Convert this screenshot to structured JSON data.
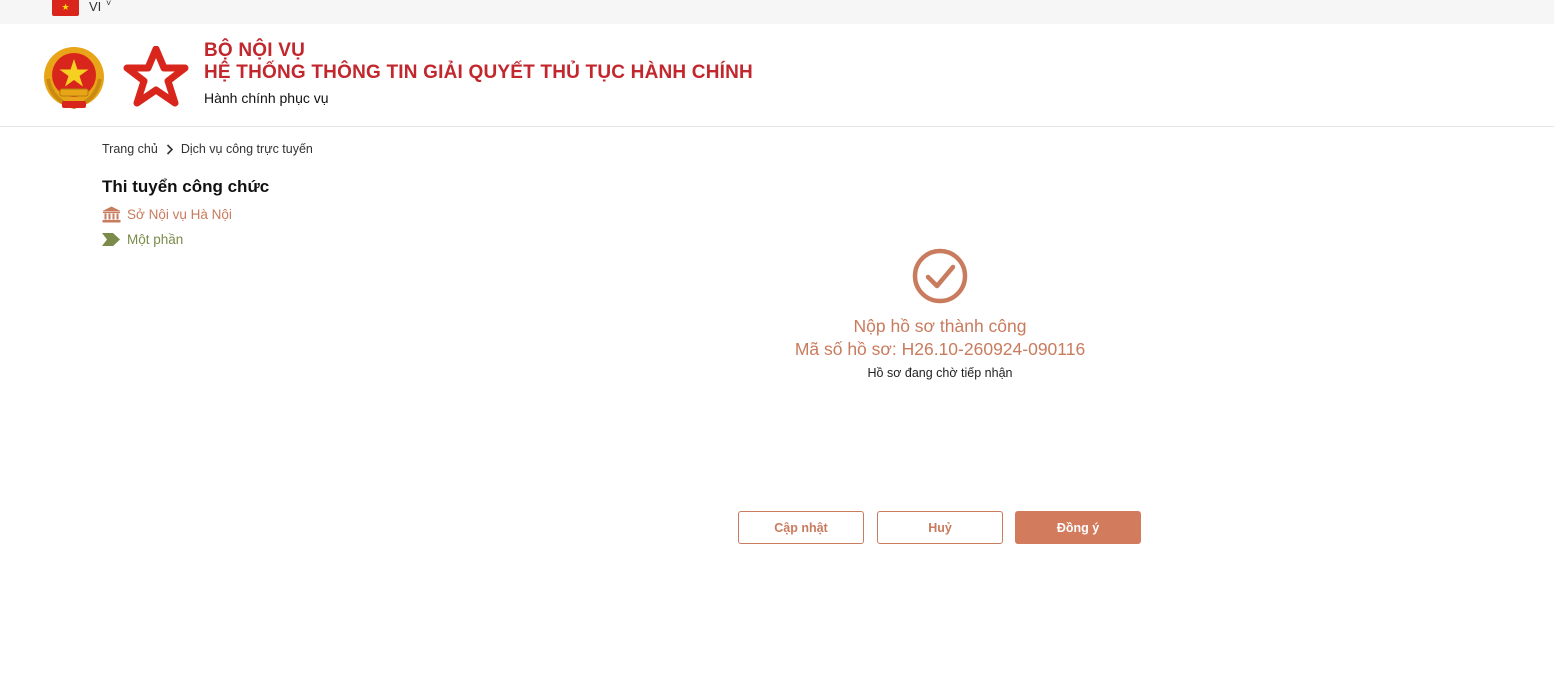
{
  "topbar": {
    "language": "VI",
    "chevron": "˅",
    "flag_icon": "vietnam-flag-icon"
  },
  "header": {
    "ministry": "BỘ NỘI VỤ",
    "system_title": "HỆ THỐNG THÔNG TIN GIẢI QUYẾT THỦ TỤC HÀNH CHÍNH",
    "slogan": "Hành chính phục vụ",
    "brand_color": "#c2272d"
  },
  "breadcrumb": {
    "home": "Trang chủ",
    "current": "Dịch vụ công trực tuyến"
  },
  "procedure": {
    "title": "Thi tuyển công chức",
    "agency": "Sở Nội vụ Hà Nội",
    "level": "Một phần",
    "agency_icon": "building-icon",
    "level_icon": "arrow-tag-icon"
  },
  "result": {
    "icon": "check-circle-icon",
    "title": "Nộp hồ sơ thành công",
    "code": "Mã số hồ sơ: H26.10-260924-090116",
    "status": "Hồ sơ đang chờ tiếp nhận",
    "accent_color": "#c97b5d"
  },
  "actions": {
    "update_label": "Cập nhật",
    "cancel_label": "Huỷ",
    "ok_label": "Đồng ý"
  }
}
